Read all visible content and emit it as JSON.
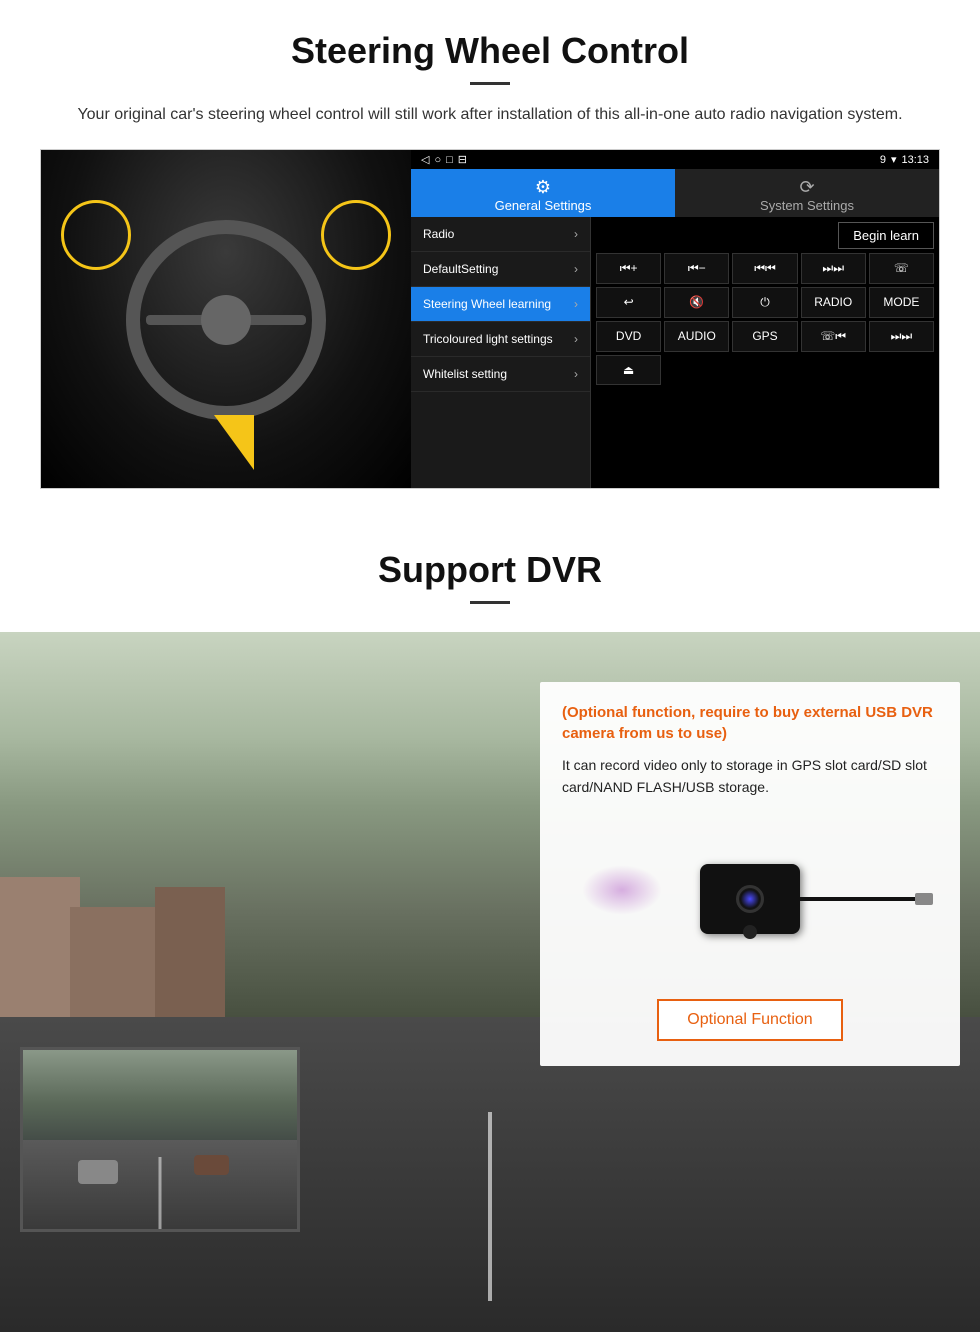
{
  "steering": {
    "title": "Steering Wheel Control",
    "subtitle": "Your original car's steering wheel control will still work after installation of this all-in-one auto radio navigation system.",
    "status_bar": {
      "time": "13:13",
      "icons": "9 ▾"
    },
    "nav_icons": [
      "◁",
      "○",
      "□",
      "⊟"
    ],
    "tabs": {
      "general": {
        "icon": "⚙",
        "label": "General Settings"
      },
      "system": {
        "icon": "🔄",
        "label": "System Settings"
      }
    },
    "menu_items": [
      {
        "label": "Radio",
        "active": false
      },
      {
        "label": "DefaultSetting",
        "active": false
      },
      {
        "label": "Steering Wheel learning",
        "active": true
      },
      {
        "label": "Tricoloured light settings",
        "active": false
      },
      {
        "label": "Whitelist setting",
        "active": false
      }
    ],
    "begin_learn": "Begin learn",
    "control_buttons": [
      [
        "⏮+",
        "⏮-",
        "⏮⏮",
        "⏭⏭",
        "📞"
      ],
      [
        "↩",
        "🔇",
        "⏻",
        "RADIO",
        "MODE"
      ],
      [
        "DVD",
        "AUDIO",
        "GPS",
        "📞⏮⏭",
        "⏭⏭"
      ]
    ]
  },
  "dvr": {
    "title": "Support DVR",
    "optional_note": "(Optional function, require to buy external USB DVR camera from us to use)",
    "description": "It can record video only to storage in GPS slot card/SD slot card/NAND FLASH/USB storage.",
    "optional_function_label": "Optional Function"
  }
}
